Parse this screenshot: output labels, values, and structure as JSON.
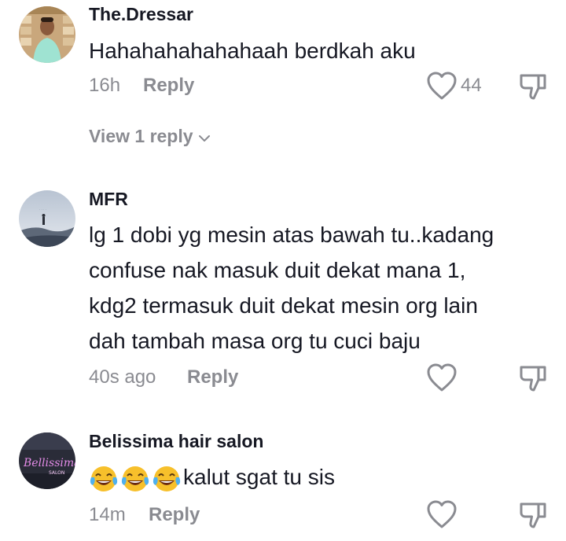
{
  "comments": [
    {
      "username": "The.Dressar",
      "text": "Hahahahahahahaah berdkah aku",
      "time": "16h",
      "reply_label": "Reply",
      "like_count": "44",
      "view_replies": "View 1 reply"
    },
    {
      "username": "MFR",
      "text_lines": [
        "lg 1 dobi yg mesin atas bawah tu..kadang",
        "confuse nak masuk duit dekat mana 1,",
        "kdg2 termasuk duit dekat mesin org lain",
        "dah tambah masa org tu cuci baju"
      ],
      "time": "40s ago",
      "reply_label": "Reply"
    },
    {
      "username": "Belissima hair salon",
      "emoji_prefix": "😂😂😂",
      "text": "kalut sgat tu sis",
      "time": "14m",
      "reply_label": "Reply",
      "avatar_text": "Bellissima",
      "avatar_subtext": "SALON"
    }
  ],
  "icons": {
    "like": "heart-outline-icon",
    "dislike": "thumbs-down-outline-icon",
    "expand": "chevron-down-icon"
  },
  "colors": {
    "primary_text": "#161823",
    "secondary_text": "#8a8b91"
  }
}
